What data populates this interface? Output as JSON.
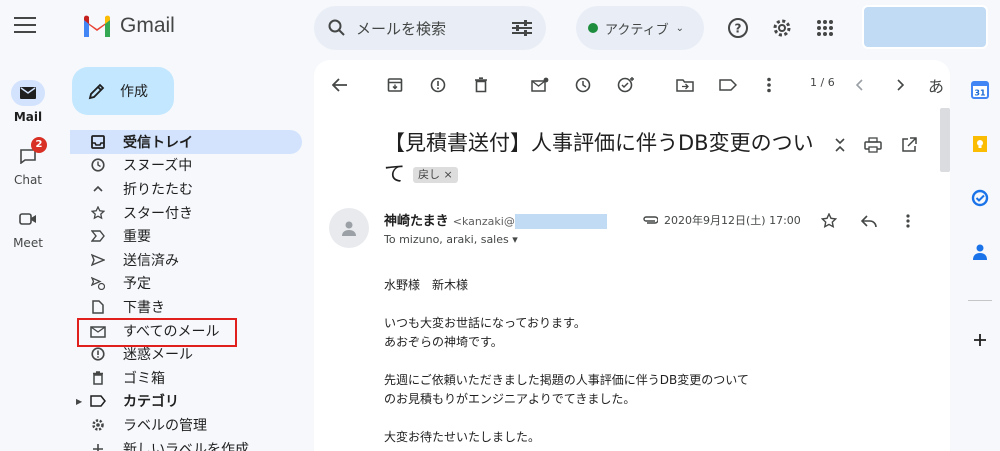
{
  "header": {
    "app_name": "Gmail",
    "search_placeholder": "メールを検索",
    "status_label": "アクティブ"
  },
  "rail": {
    "mail_label": "Mail",
    "chat_label": "Chat",
    "chat_badge": "2",
    "meet_label": "Meet"
  },
  "compose_label": "作成",
  "nav": {
    "items": [
      {
        "label": "受信トレイ",
        "icon": "inbox-icon"
      },
      {
        "label": "スヌーズ中",
        "icon": "clock-icon"
      },
      {
        "label": "折りたたむ",
        "icon": "chevron-up-icon"
      },
      {
        "label": "スター付き",
        "icon": "star-icon"
      },
      {
        "label": "重要",
        "icon": "important-icon"
      },
      {
        "label": "送信済み",
        "icon": "send-icon"
      },
      {
        "label": "予定",
        "icon": "scheduled-icon"
      },
      {
        "label": "下書き",
        "icon": "draft-icon"
      },
      {
        "label": "すべてのメール",
        "icon": "all-mail-icon"
      },
      {
        "label": "迷惑メール",
        "icon": "spam-icon"
      },
      {
        "label": "ゴミ箱",
        "icon": "trash-icon"
      },
      {
        "label": "カテゴリ",
        "icon": "label-icon"
      },
      {
        "label": "ラベルの管理",
        "icon": "gear-icon"
      },
      {
        "label": "新しいラベルを作成",
        "icon": "plus-icon"
      }
    ]
  },
  "toolbar": {
    "pager": "1 / 6",
    "lang_label": "あ"
  },
  "message": {
    "subject": "【見積書送付】人事評価に伴うDB変更のついて",
    "tag": "戻し",
    "sender_name": "神崎たまき",
    "sender_email": "<kanzaki@",
    "to": "To mizuno, araki, sales",
    "date": "2020年9月12日(土) 17:00",
    "body": [
      "水野様　新木様",
      "いつも大変お世話になっております。",
      "あおぞらの神埼です。",
      "先週にご依頼いただきました掲題の人事評価に伴うDB変更のついて",
      "のお見積もりがエンジニアよりでてきました。",
      "大変お待たせいたしました。"
    ]
  }
}
